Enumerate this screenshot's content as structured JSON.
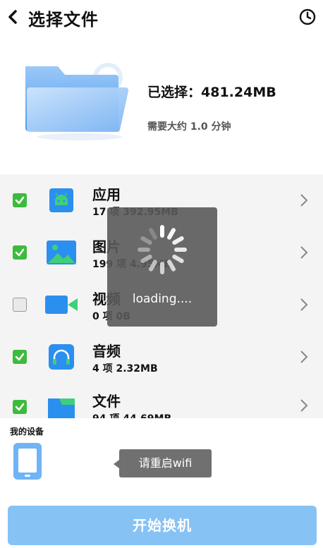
{
  "header": {
    "title": "选择文件",
    "back_icon": "back-arrow-icon",
    "history_icon": "clock-icon"
  },
  "summary": {
    "selected_text": "已选择：481.24MB",
    "estimate_text": "需要大约 1.0 分钟"
  },
  "categories": [
    {
      "name": "应用",
      "info": "17 项 392.95MB",
      "checked": true,
      "icon": "android-icon"
    },
    {
      "name": "图片",
      "info": "199 项 4.95MB",
      "checked": true,
      "icon": "image-icon"
    },
    {
      "name": "视频",
      "info": "0 项 0B",
      "checked": false,
      "icon": "video-icon"
    },
    {
      "name": "音频",
      "info": "4 项 2.32MB",
      "checked": true,
      "icon": "headphones-icon"
    },
    {
      "name": "文件",
      "info": "94 项 44.69MB",
      "checked": true,
      "icon": "folder-icon"
    }
  ],
  "loading": {
    "text": "loading...."
  },
  "devices": {
    "label": "我的设备",
    "device_icon": "phone-icon"
  },
  "toast": {
    "text": "请重启wifi"
  },
  "start_button": {
    "label": "开始换机"
  },
  "colors": {
    "accent_blue": "#86c2f4",
    "icon_blue": "#2b8ff0",
    "check_green": "#3dbb3d",
    "list_bg": "#f4f4f4"
  }
}
